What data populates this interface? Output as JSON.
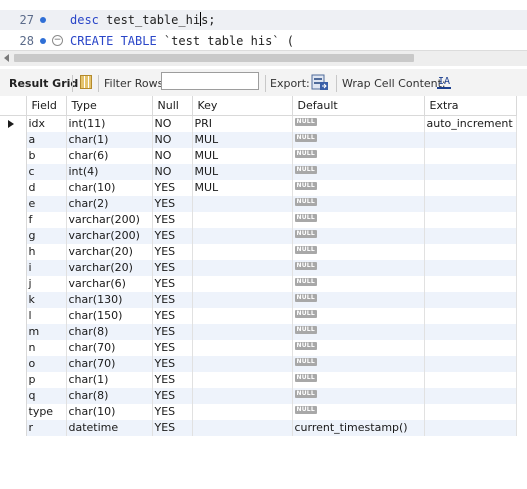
{
  "editor": {
    "lines": [
      {
        "num": "27",
        "kw": "desc",
        "before_caret": " test_table_hi",
        "after_caret": "s;"
      },
      {
        "num": "28",
        "kw": "CREATE TABLE",
        "rest": " `test table his` ("
      }
    ]
  },
  "toolbar": {
    "result_grid": "Result Grid",
    "filter_rows": "Filter Rows:",
    "filter_value": "",
    "export": "Export:",
    "wrap_cell": "Wrap Cell Content:",
    "wrap_icon": "IA"
  },
  "grid": {
    "columns": [
      "Field",
      "Type",
      "Null",
      "Key",
      "Default",
      "Extra"
    ],
    "null_badge": "NULL",
    "rows": [
      {
        "field": "idx",
        "type": "int(11)",
        "null": "NO",
        "key": "PRI",
        "default": null,
        "extra": "auto_increment"
      },
      {
        "field": "a",
        "type": "char(1)",
        "null": "NO",
        "key": "MUL",
        "default": null,
        "extra": ""
      },
      {
        "field": "b",
        "type": "char(6)",
        "null": "NO",
        "key": "MUL",
        "default": null,
        "extra": ""
      },
      {
        "field": "c",
        "type": "int(4)",
        "null": "NO",
        "key": "MUL",
        "default": null,
        "extra": ""
      },
      {
        "field": "d",
        "type": "char(10)",
        "null": "YES",
        "key": "MUL",
        "default": null,
        "extra": ""
      },
      {
        "field": "e",
        "type": "char(2)",
        "null": "YES",
        "key": "",
        "default": null,
        "extra": ""
      },
      {
        "field": "f",
        "type": "varchar(200)",
        "null": "YES",
        "key": "",
        "default": null,
        "extra": ""
      },
      {
        "field": "g",
        "type": "varchar(200)",
        "null": "YES",
        "key": "",
        "default": null,
        "extra": ""
      },
      {
        "field": "h",
        "type": "varchar(20)",
        "null": "YES",
        "key": "",
        "default": null,
        "extra": ""
      },
      {
        "field": "i",
        "type": "varchar(20)",
        "null": "YES",
        "key": "",
        "default": null,
        "extra": ""
      },
      {
        "field": "j",
        "type": "varchar(6)",
        "null": "YES",
        "key": "",
        "default": null,
        "extra": ""
      },
      {
        "field": "k",
        "type": "char(130)",
        "null": "YES",
        "key": "",
        "default": null,
        "extra": ""
      },
      {
        "field": "l",
        "type": "char(150)",
        "null": "YES",
        "key": "",
        "default": null,
        "extra": ""
      },
      {
        "field": "m",
        "type": "char(8)",
        "null": "YES",
        "key": "",
        "default": null,
        "extra": ""
      },
      {
        "field": "n",
        "type": "char(70)",
        "null": "YES",
        "key": "",
        "default": null,
        "extra": ""
      },
      {
        "field": "o",
        "type": "char(70)",
        "null": "YES",
        "key": "",
        "default": null,
        "extra": ""
      },
      {
        "field": "p",
        "type": "char(1)",
        "null": "YES",
        "key": "",
        "default": null,
        "extra": ""
      },
      {
        "field": "q",
        "type": "char(8)",
        "null": "YES",
        "key": "",
        "default": null,
        "extra": ""
      },
      {
        "field": "type",
        "type": "char(10)",
        "null": "YES",
        "key": "",
        "default": null,
        "extra": ""
      },
      {
        "field": "r",
        "type": "datetime",
        "null": "YES",
        "key": "",
        "default": "current_timestamp()",
        "extra": ""
      }
    ]
  },
  "colors": {
    "keyword": "#2a46c8",
    "row_alt": "#eef3fb",
    "null_badge": "#a8a8a8",
    "breakpoint": "#2f6fd6"
  }
}
